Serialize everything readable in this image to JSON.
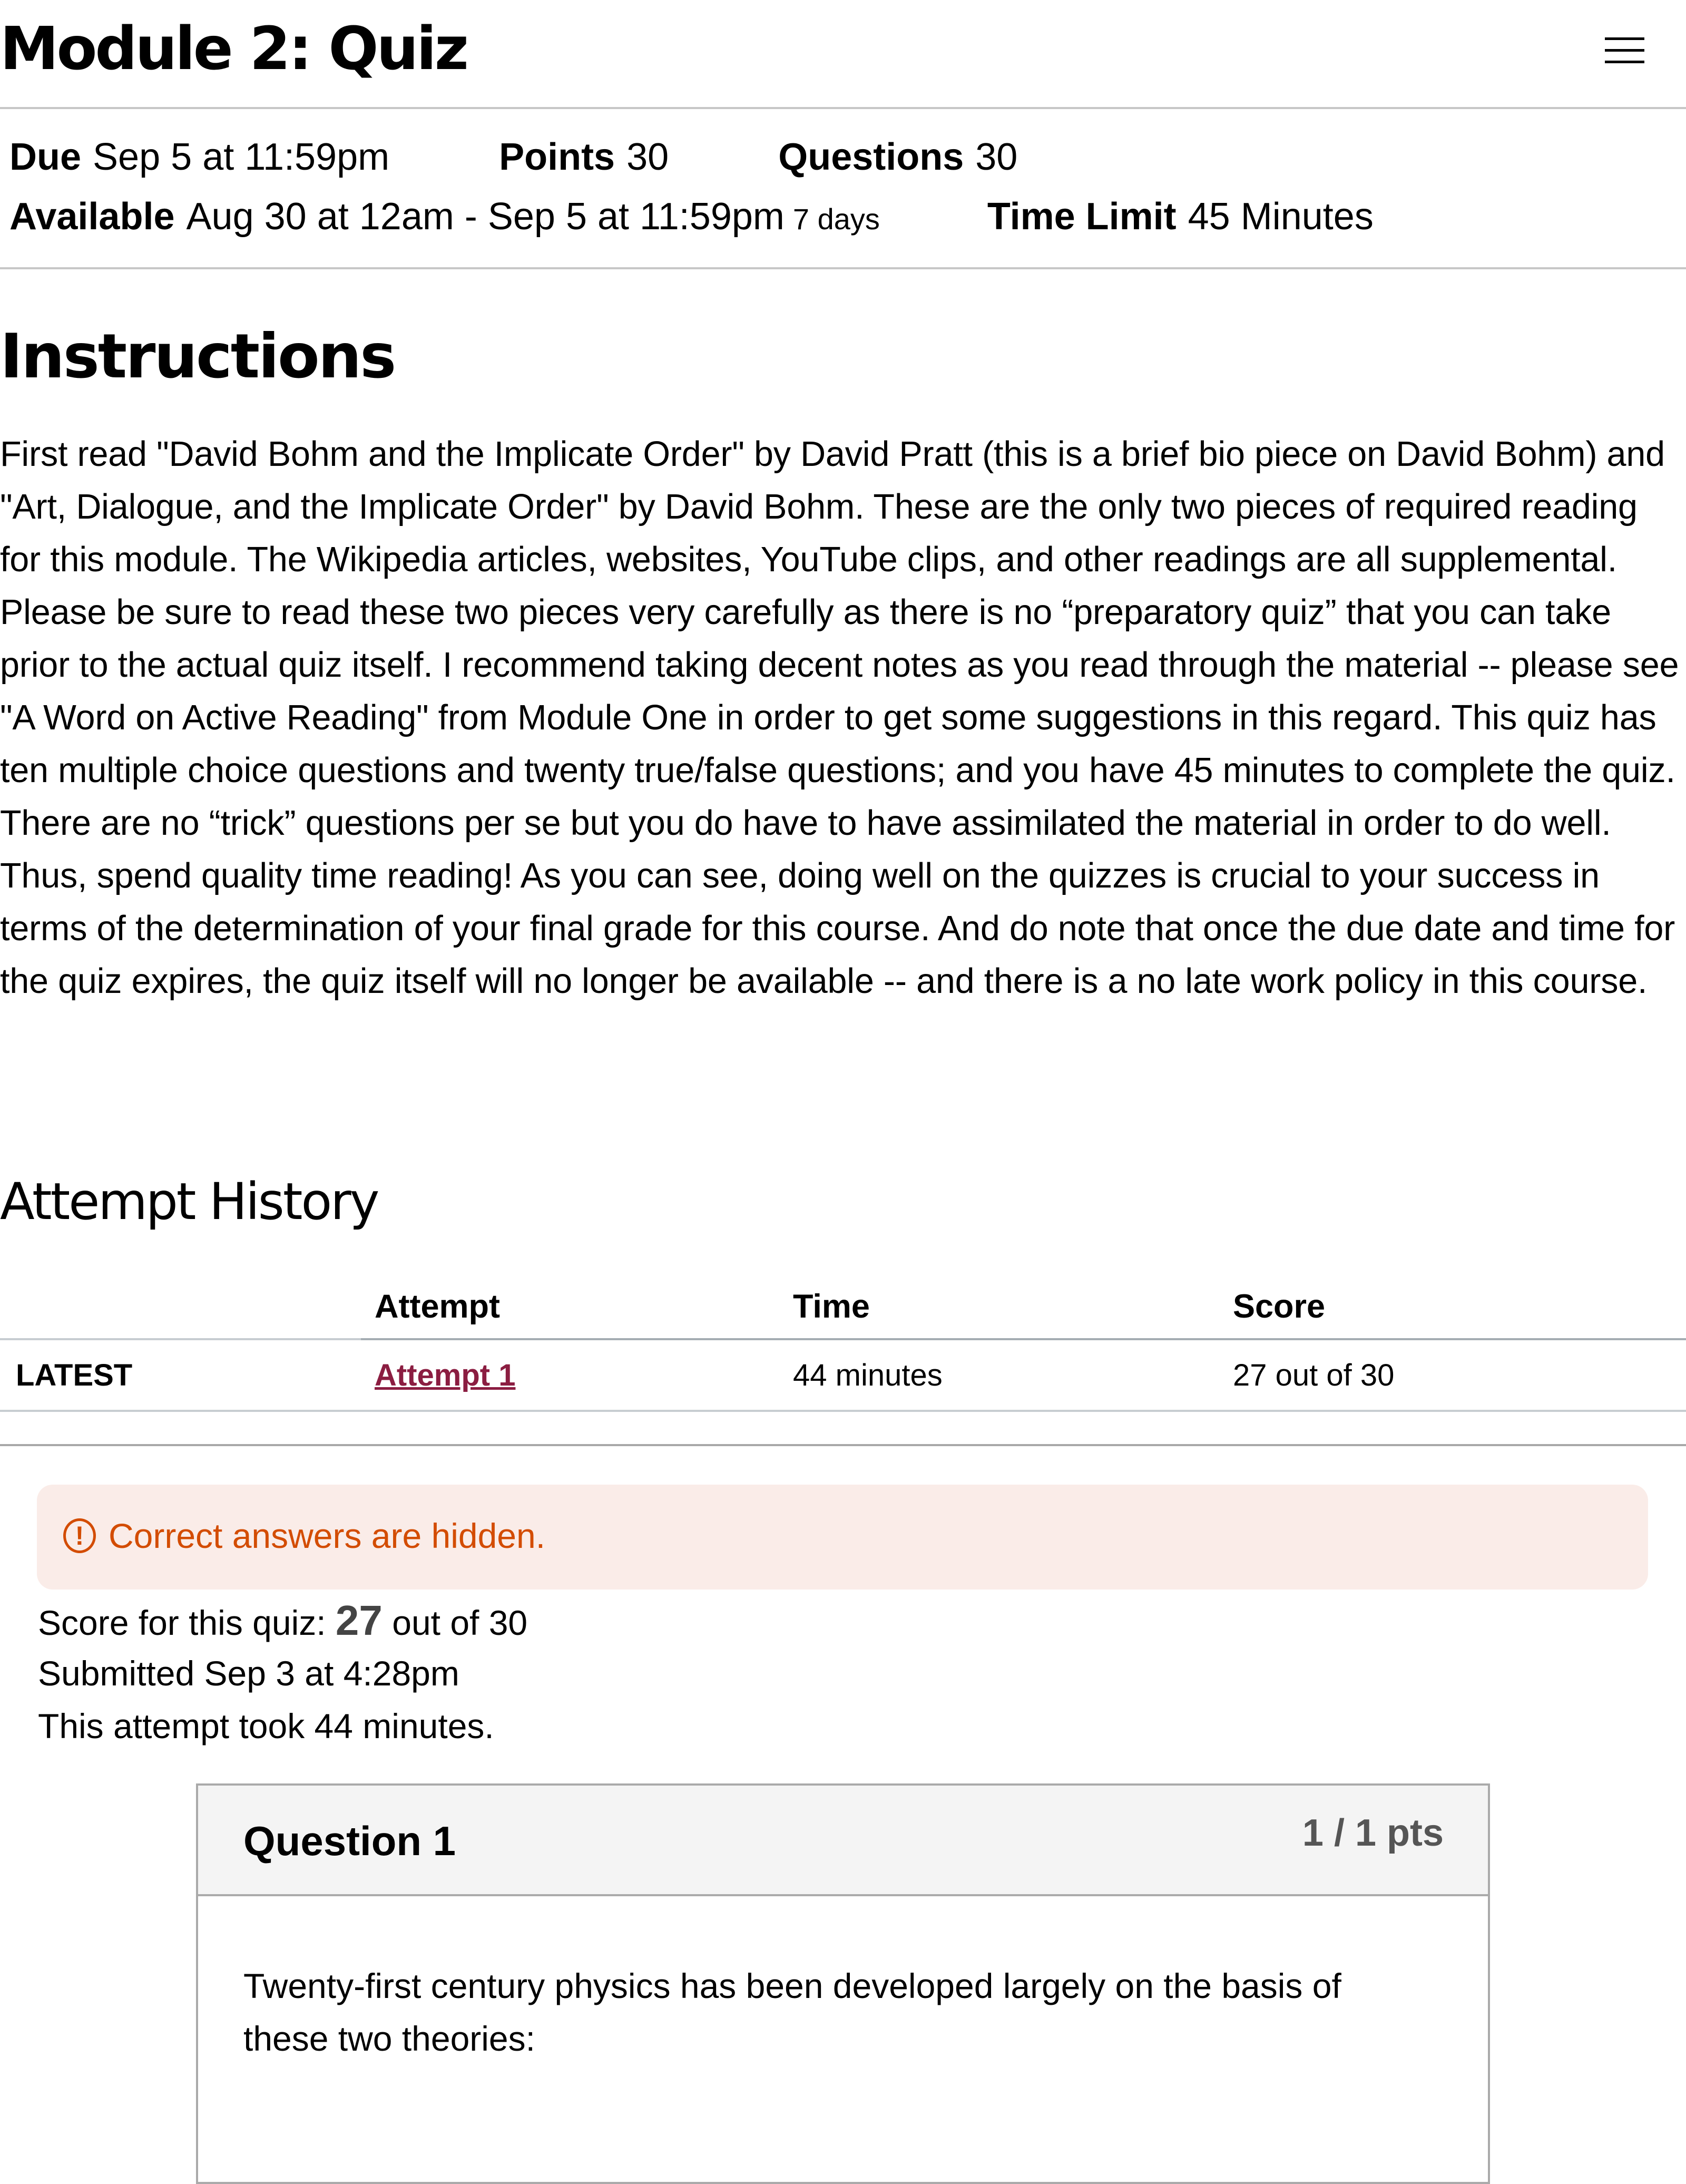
{
  "header": {
    "title": "Module 2: Quiz",
    "menu_icon": "hamburger-menu-icon"
  },
  "details": {
    "due_label": "Due",
    "due_value": "Sep 5 at 11:59pm",
    "points_label": "Points",
    "points_value": "30",
    "questions_label": "Questions",
    "questions_value": "30",
    "available_label": "Available",
    "available_value": "Aug 30 at 12am - Sep 5 at 11:59pm",
    "available_duration": "7 days",
    "time_limit_label": "Time Limit",
    "time_limit_value": "45 Minutes"
  },
  "instructions": {
    "heading": "Instructions",
    "body": "First read \"David Bohm and the Implicate Order\" by David Pratt (this is a brief bio piece on David Bohm) and \"Art, Dialogue, and the Implicate Order\" by David Bohm. These are the only two pieces of required reading for this module. The Wikipedia articles, websites, YouTube clips, and other readings are all supplemental. Please be sure to read these two pieces very carefully as there is no “preparatory quiz” that you can take prior to the actual quiz itself.  I recommend taking decent notes as you read through the material -- please see \"A Word on Active Reading\" from Module One in order to get some suggestions in this regard.  This quiz has ten multiple choice questions and twenty true/false questions; and you have 45 minutes to complete the quiz. There are no “trick” questions per se but you do have to have assimilated the material in order to do well. Thus, spend quality time reading!  As you can see, doing well on the quizzes is crucial to your success in terms of the determination of your final grade for this course.  And do note that once the due date and time for the quiz expires, the quiz itself will no longer be available -- and there is a no late work policy in this course."
  },
  "attempt_history": {
    "heading": "Attempt History",
    "columns": [
      "",
      "Attempt",
      "Time",
      "Score"
    ],
    "rows": [
      {
        "tag": "LATEST",
        "attempt": "Attempt 1",
        "time": "44 minutes",
        "score": "27 out of 30"
      }
    ]
  },
  "alert": {
    "icon": "warning-circle-icon",
    "icon_glyph": "!",
    "text": "Correct answers are hidden.",
    "color": "#d34c00",
    "background": "#faece8"
  },
  "summary": {
    "score_prefix": "Score for this quiz:",
    "score_value": "27",
    "score_suffix": "out of 30",
    "submitted": "Submitted Sep 3 at 4:28pm",
    "duration": "This attempt took 44 minutes."
  },
  "questions": [
    {
      "title": "Question 1",
      "points": "1 / 1 pts",
      "text": "Twenty-first century physics has been developed largely on the basis of these two theories:"
    }
  ],
  "colors": {
    "link": "#8b1d41",
    "alert_text": "#d34c00",
    "question_header_bg": "#f4f4f4"
  }
}
